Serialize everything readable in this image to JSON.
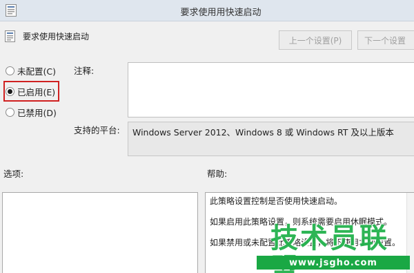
{
  "window": {
    "title": "要求使用用快速启动"
  },
  "header": {
    "policy_name": "要求使用快速启动",
    "prev_button": "上一个设置(P)",
    "next_button": "下一个设置"
  },
  "state_options": [
    {
      "label": "未配置(C)",
      "checked": false
    },
    {
      "label": "已启用(E)",
      "checked": true
    },
    {
      "label": "已禁用(D)",
      "checked": false
    }
  ],
  "comment": {
    "label": "注释:",
    "value": ""
  },
  "platform": {
    "label": "支持的平台:",
    "value": "Windows Server 2012、Windows 8 或 Windows RT 及以上版本"
  },
  "options_section": {
    "label": "选项:"
  },
  "help_section": {
    "label": "帮助:",
    "paragraphs": [
      "此策略设置控制是否使用快速启动。",
      "如果启用此策略设置，则系统需要启用休眠模式。",
      "如果禁用或未配置此策略设置，将不使用本地设置。"
    ]
  },
  "watermark": {
    "logo": "技术员联盟",
    "url": "www.jsgho.com"
  },
  "colors": {
    "highlight": "#d02020",
    "watermark_green": "#22b24c"
  }
}
